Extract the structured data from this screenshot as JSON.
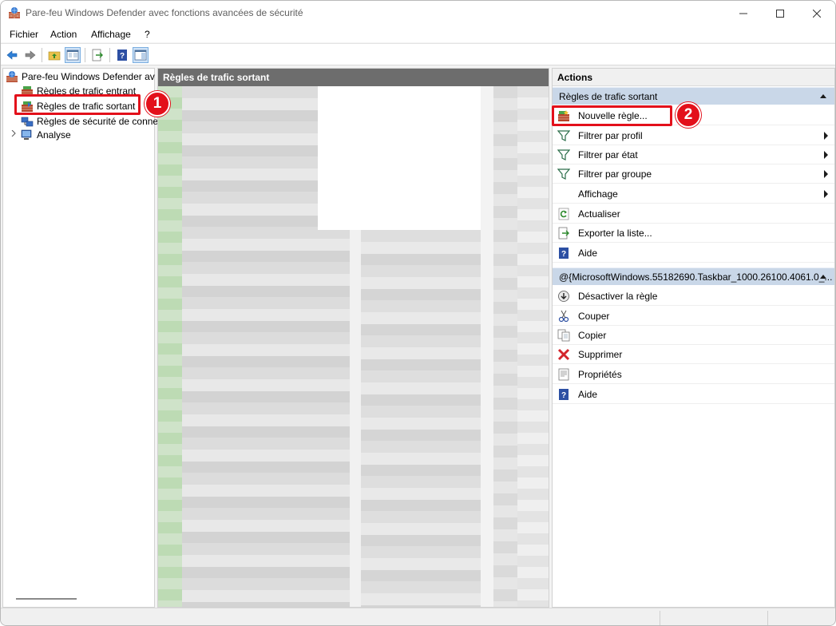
{
  "window": {
    "title": "Pare-feu Windows Defender avec fonctions avancées de sécurité"
  },
  "menu": [
    {
      "label": "Fichier"
    },
    {
      "label": "Action"
    },
    {
      "label": "Affichage"
    },
    {
      "label": "?"
    }
  ],
  "tree": {
    "root": "Pare-feu Windows Defender av",
    "items": [
      {
        "label": "Règles de trafic entrant"
      },
      {
        "label": "Règles de trafic sortant",
        "selected": true
      },
      {
        "label": "Règles de sécurité de conne"
      },
      {
        "label": "Analyse"
      }
    ]
  },
  "middle": {
    "header": "Règles de trafic sortant"
  },
  "actions": {
    "title": "Actions",
    "section1": {
      "title": "Règles de trafic sortant",
      "items": [
        {
          "label": "Nouvelle règle...",
          "icon": "new-rule-icon",
          "submenu": false
        },
        {
          "label": "Filtrer par profil",
          "icon": "filter-icon",
          "submenu": true
        },
        {
          "label": "Filtrer par état",
          "icon": "filter-icon",
          "submenu": true
        },
        {
          "label": "Filtrer par groupe",
          "icon": "filter-icon",
          "submenu": true
        },
        {
          "label": "Affichage",
          "icon": "",
          "submenu": true
        },
        {
          "label": "Actualiser",
          "icon": "refresh-icon",
          "submenu": false
        },
        {
          "label": "Exporter la liste...",
          "icon": "export-icon",
          "submenu": false
        },
        {
          "label": "Aide",
          "icon": "help-icon",
          "submenu": false
        }
      ]
    },
    "section2": {
      "title": "@{MicrosoftWindows.55182690.Taskbar_1000.26100.4061.0_...",
      "items": [
        {
          "label": "Désactiver la règle",
          "icon": "disable-icon"
        },
        {
          "label": "Couper",
          "icon": "cut-icon"
        },
        {
          "label": "Copier",
          "icon": "copy-icon"
        },
        {
          "label": "Supprimer",
          "icon": "delete-icon"
        },
        {
          "label": "Propriétés",
          "icon": "properties-icon"
        },
        {
          "label": "Aide",
          "icon": "help-icon"
        }
      ]
    }
  },
  "annotations": {
    "badge1": "1",
    "badge2": "2"
  },
  "colors": {
    "highlight": "#e3101b",
    "section_header": "#c9d7e8",
    "mid_header": "#6d6d6d"
  }
}
